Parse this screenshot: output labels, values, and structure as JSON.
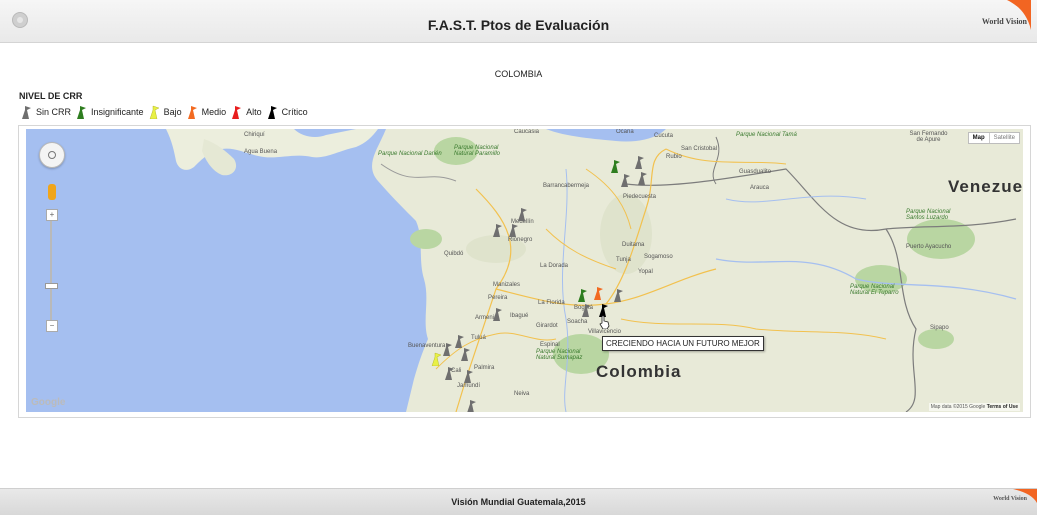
{
  "header": {
    "title": "F.A.S.T. Ptos de Evaluación",
    "brand": "World Vision",
    "brand_color": "#f26522"
  },
  "country": "COLOMBIA",
  "legend": {
    "title": "NIVEL DE CRR",
    "items": [
      {
        "label": "Sin CRR",
        "color": "#6f6f6f"
      },
      {
        "label": "Insignificante",
        "color": "#2e7d1f"
      },
      {
        "label": "Bajo",
        "color": "#e8f046"
      },
      {
        "label": "Medio",
        "color": "#f26a21"
      },
      {
        "label": "Alto",
        "color": "#e81e1e"
      },
      {
        "label": "Crítico",
        "color": "#000000"
      }
    ]
  },
  "map": {
    "type_options": [
      "Map",
      "Satellite"
    ],
    "selected_type": "Map",
    "zoom_in": "+",
    "zoom_out": "−",
    "logo": "Google",
    "attribution": "Map data ©2015 Google",
    "terms": "Terms of Use",
    "tooltip": "CRECIENDO HACIA UN FUTURO MEJOR",
    "labels": {
      "country_colombia": "Colombia",
      "country_venezuela": "Venezue",
      "chiriqui": "Chiriquí",
      "agua_buena": "Agua Buena",
      "caucasia": "Caucasia",
      "ocana": "Ocaña",
      "cucuta": "Cucuta",
      "san_cristobal": "San Cristobal",
      "rubio": "Rubio",
      "san_fernando": "San Fernando de Apure",
      "barrancabermeja": "Barrancabermeja",
      "piedecuesta": "Piedecuesta",
      "guasdualito": "Guasdualito",
      "arauca": "Arauca",
      "medellin": "Medellín",
      "rionegro": "Rionegro",
      "quibdo": "Quibdó",
      "duitama": "Duitama",
      "sogamoso": "Sogamoso",
      "tunja": "Tunja",
      "yopal": "Yopal",
      "la_dorada": "La Dorada",
      "manizales": "Manizales",
      "pereira": "Pereira",
      "armenia": "Armenia",
      "ibague": "Ibagué",
      "la_florida": "La Florida",
      "bogota": "Bogotá",
      "soacha": "Soacha",
      "girardot": "Girardot",
      "villavicencio": "Villavicencio",
      "tulua": "Tuluá",
      "buenaventura": "Buenaventura",
      "cali": "Cali",
      "palmira": "Palmira",
      "jamundi": "Jamundí",
      "neiva": "Neiva",
      "espinal": "Espinal",
      "puerto_ayacucho": "Puerto Ayacucho",
      "sipapo": "Sipapo",
      "park_darien": "Parque Nacional Darién",
      "park_paramillo": "Parque Nacional Natural Paramillo",
      "park_tama": "Parque Nacional Tamá",
      "park_santos_luzardo": "Parque Nacional Santos Luzardo",
      "park_tuparro": "Parque Nacional Natural El Tuparro",
      "park_sumapaz": "Parque Nacional Natural Sumapaz"
    }
  },
  "footer": {
    "text": "Visión Mundial Guatemala,2015",
    "brand": "World Vision"
  }
}
